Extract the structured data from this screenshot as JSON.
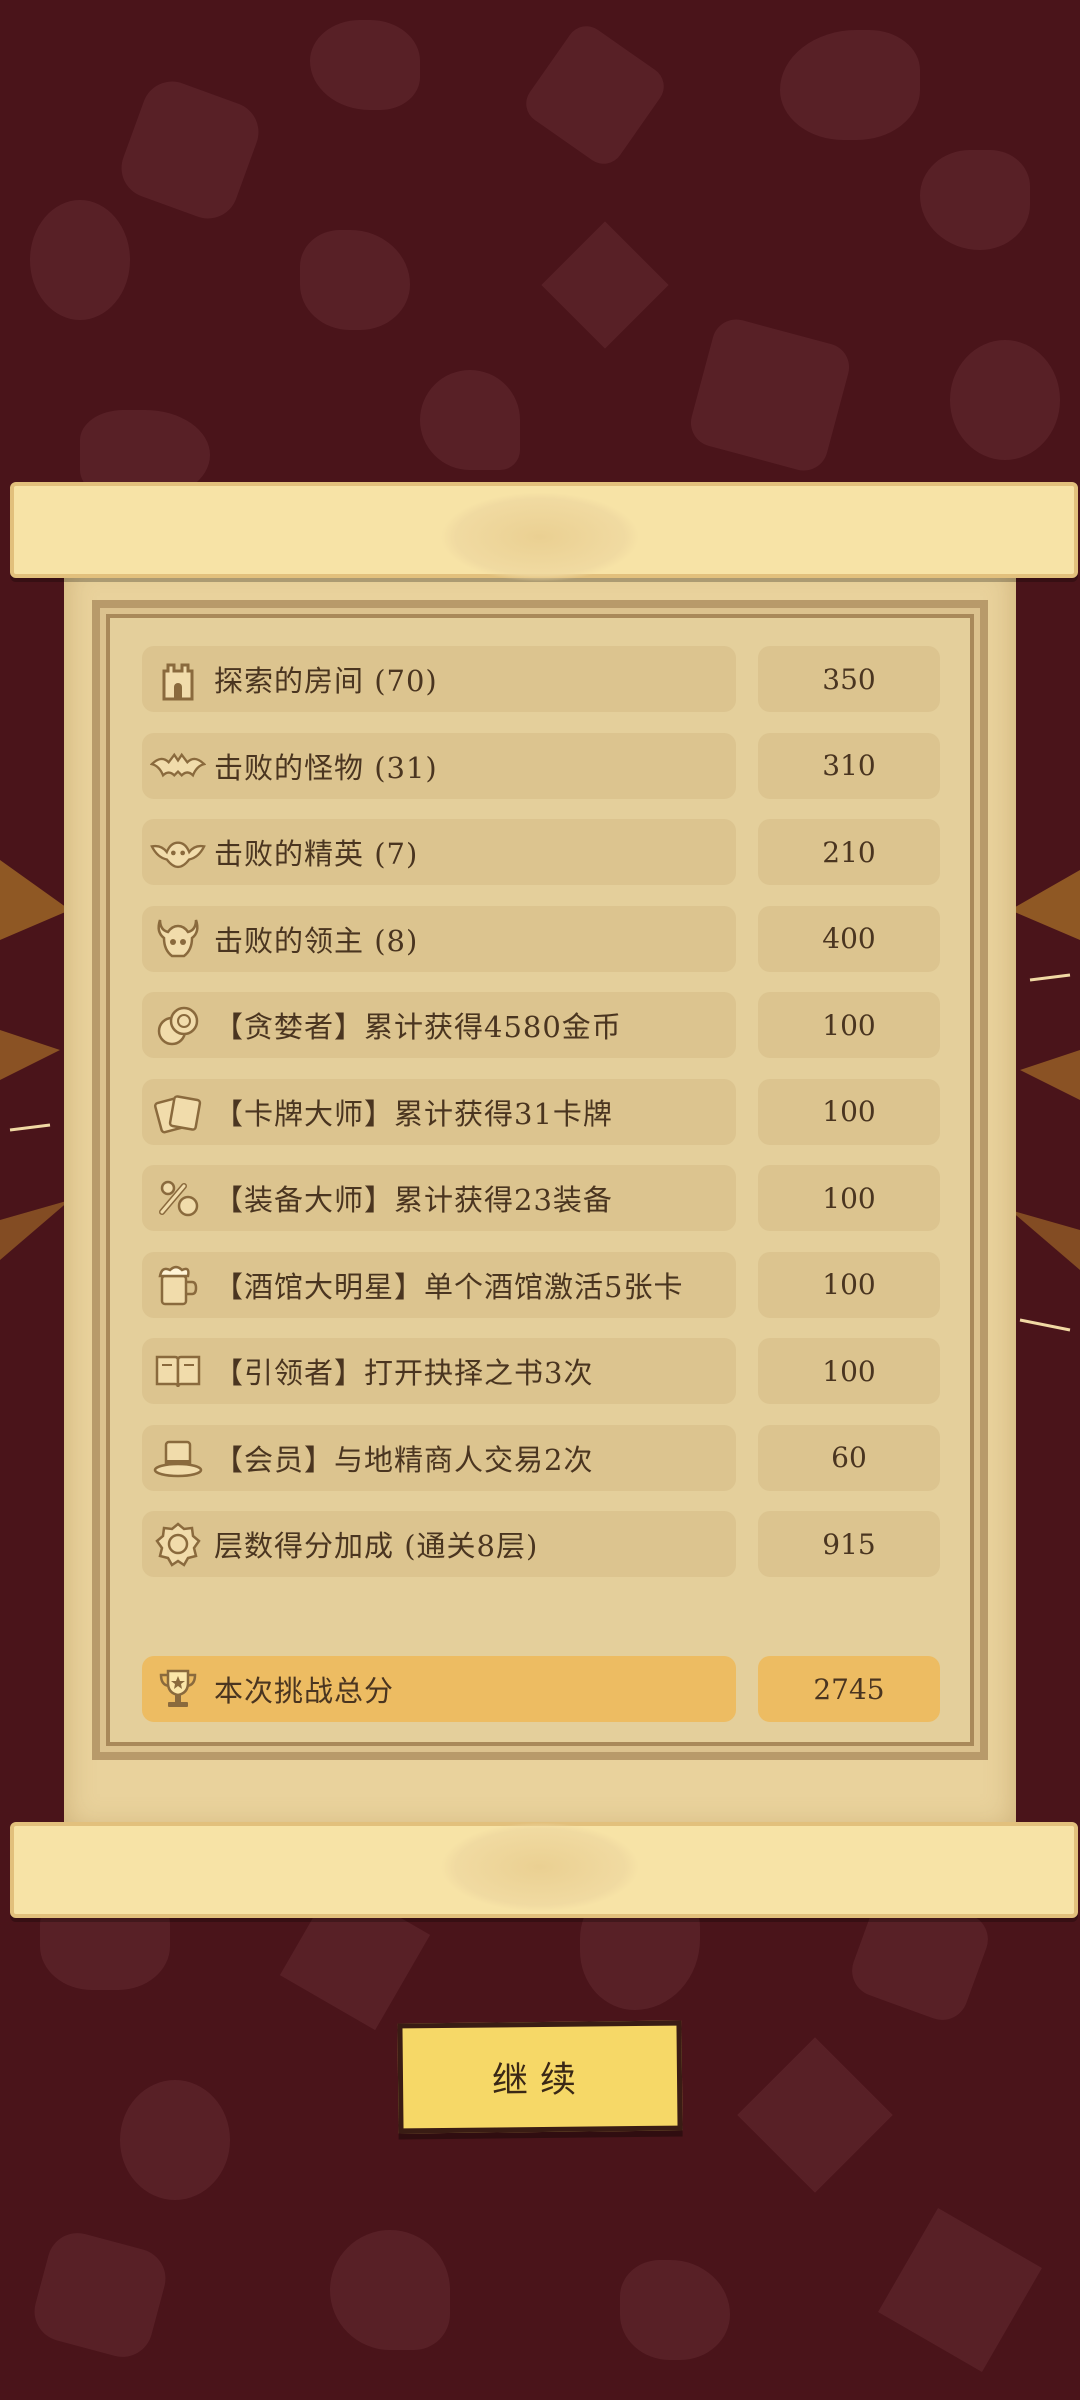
{
  "rows": [
    {
      "label": "探索的房间 (70)",
      "value": "350",
      "icon": "castle-icon"
    },
    {
      "label": "击败的怪物 (31)",
      "value": "310",
      "icon": "bat-icon"
    },
    {
      "label": "击败的精英 (7)",
      "value": "210",
      "icon": "winged-demon-icon"
    },
    {
      "label": "击败的领主 (8)",
      "value": "400",
      "icon": "horned-skull-icon"
    },
    {
      "label": "【贪婪者】累计获得4580金币",
      "value": "100",
      "icon": "coins-icon"
    },
    {
      "label": "【卡牌大师】累计获得31卡牌",
      "value": "100",
      "icon": "cards-icon"
    },
    {
      "label": "【装备大师】累计获得23装备",
      "value": "100",
      "icon": "equipment-icon"
    },
    {
      "label": "【酒馆大明星】单个酒馆激活5张卡",
      "value": "100",
      "icon": "beer-mug-icon"
    },
    {
      "label": "【引领者】打开抉择之书3次",
      "value": "100",
      "icon": "open-book-icon"
    },
    {
      "label": "【会员】与地精商人交易2次",
      "value": "60",
      "icon": "top-hat-icon"
    },
    {
      "label": "层数得分加成 (通关8层)",
      "value": "915",
      "icon": "floor-badge-icon"
    }
  ],
  "total": {
    "label": "本次挑战总分",
    "value": "2745",
    "icon": "trophy-icon"
  },
  "continue_label": "继续",
  "colors": {
    "background": "#4a141a",
    "parchment": "#e9d29c",
    "row_fill": "#dcc48f",
    "total_fill": "#edbc62",
    "button": "#f6d867"
  }
}
